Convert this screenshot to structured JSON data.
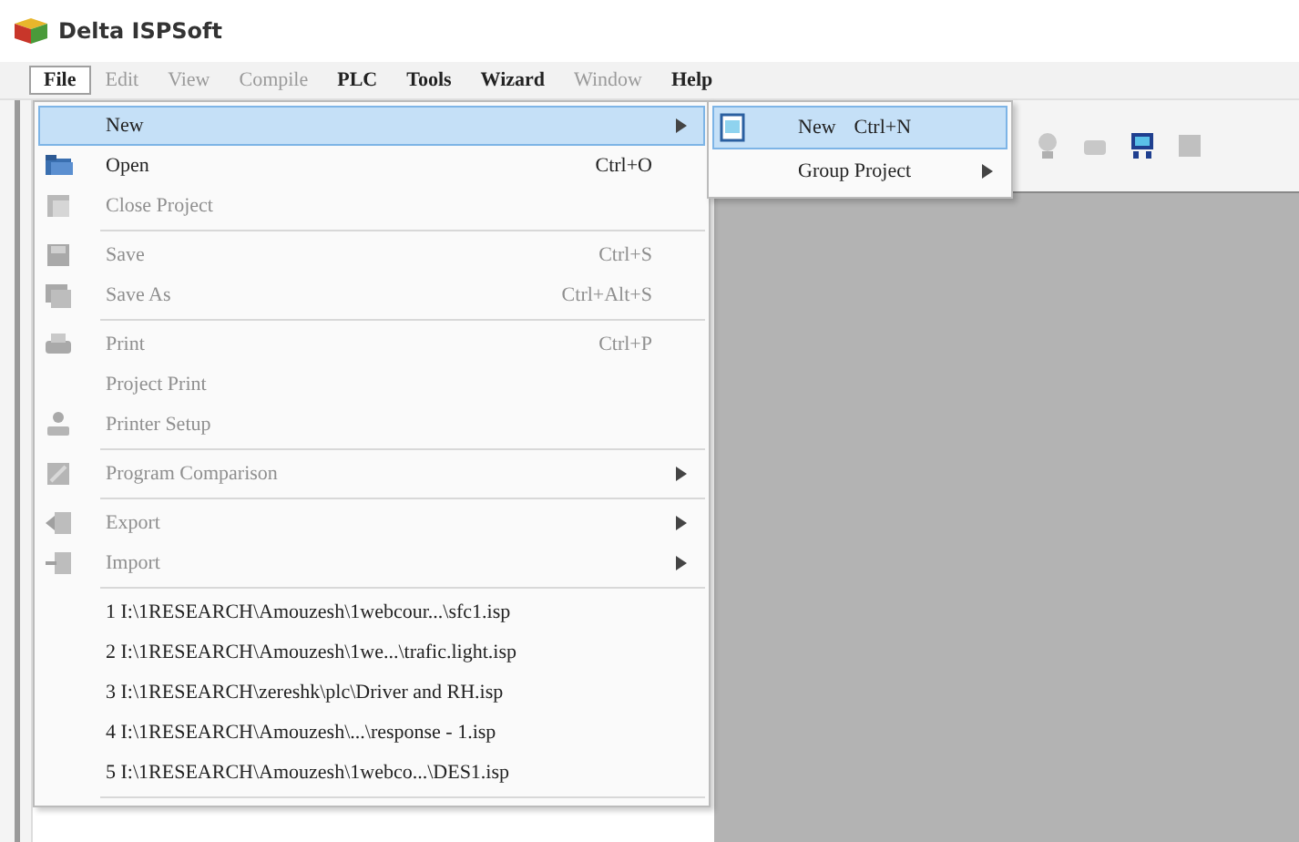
{
  "window": {
    "title": "Delta ISPSoft"
  },
  "menubar": [
    {
      "label": "File",
      "selected": true,
      "disabled": false
    },
    {
      "label": "Edit",
      "selected": false,
      "disabled": true
    },
    {
      "label": "View",
      "selected": false,
      "disabled": true
    },
    {
      "label": "Compile",
      "selected": false,
      "disabled": true
    },
    {
      "label": "PLC",
      "selected": false,
      "disabled": false
    },
    {
      "label": "Tools",
      "selected": false,
      "disabled": false
    },
    {
      "label": "Wizard",
      "selected": false,
      "disabled": false
    },
    {
      "label": "Window",
      "selected": false,
      "disabled": true
    },
    {
      "label": "Help",
      "selected": false,
      "disabled": false
    }
  ],
  "file_menu": [
    {
      "kind": "item",
      "label": "New",
      "selected": true,
      "disabled": false,
      "submenu": true,
      "icon": false
    },
    {
      "kind": "item",
      "label": "Open",
      "shortcut": "Ctrl+O",
      "selected": false,
      "disabled": false,
      "submenu": false,
      "icon": true
    },
    {
      "kind": "item",
      "label": "Close Project",
      "selected": false,
      "disabled": true,
      "submenu": false,
      "icon": true
    },
    {
      "kind": "separator"
    },
    {
      "kind": "item",
      "label": "Save",
      "shortcut": "Ctrl+S",
      "selected": false,
      "disabled": true,
      "submenu": false,
      "icon": true
    },
    {
      "kind": "item",
      "label": "Save As",
      "shortcut": "Ctrl+Alt+S",
      "selected": false,
      "disabled": true,
      "submenu": false,
      "icon": true
    },
    {
      "kind": "separator"
    },
    {
      "kind": "item",
      "label": "Print",
      "shortcut": "Ctrl+P",
      "selected": false,
      "disabled": true,
      "submenu": false,
      "icon": true
    },
    {
      "kind": "item",
      "label": "Project Print",
      "selected": false,
      "disabled": true,
      "submenu": false,
      "icon": false
    },
    {
      "kind": "item",
      "label": "Printer Setup",
      "selected": false,
      "disabled": true,
      "submenu": false,
      "icon": true
    },
    {
      "kind": "separator"
    },
    {
      "kind": "item",
      "label": "Program Comparison",
      "selected": false,
      "disabled": true,
      "submenu": true,
      "icon": true
    },
    {
      "kind": "separator"
    },
    {
      "kind": "item",
      "label": "Export",
      "selected": false,
      "disabled": true,
      "submenu": true,
      "icon": true
    },
    {
      "kind": "item",
      "label": "Import",
      "selected": false,
      "disabled": true,
      "submenu": true,
      "icon": true
    },
    {
      "kind": "separator"
    },
    {
      "kind": "item",
      "label": "1 I:\\1RESEARCH\\Amouzesh\\1webcour...\\sfc1.isp",
      "selected": false,
      "disabled": false,
      "submenu": false,
      "icon": false
    },
    {
      "kind": "item",
      "label": "2 I:\\1RESEARCH\\Amouzesh\\1we...\\trafic.light.isp",
      "selected": false,
      "disabled": false,
      "submenu": false,
      "icon": false
    },
    {
      "kind": "item",
      "label": "3 I:\\1RESEARCH\\zereshk\\plc\\Driver and RH.isp",
      "selected": false,
      "disabled": false,
      "submenu": false,
      "icon": false
    },
    {
      "kind": "item",
      "label": "4 I:\\1RESEARCH\\Amouzesh\\...\\response - 1.isp",
      "selected": false,
      "disabled": false,
      "submenu": false,
      "icon": false
    },
    {
      "kind": "item",
      "label": "5 I:\\1RESEARCH\\Amouzesh\\1webco...\\DES1.isp",
      "selected": false,
      "disabled": false,
      "submenu": false,
      "icon": false
    },
    {
      "kind": "separator"
    }
  ],
  "new_submenu": [
    {
      "label": "New",
      "shortcut": "Ctrl+N",
      "selected": true,
      "submenu": false,
      "icon": true
    },
    {
      "label": "Group Project",
      "selected": false,
      "submenu": true,
      "icon": false
    }
  ]
}
